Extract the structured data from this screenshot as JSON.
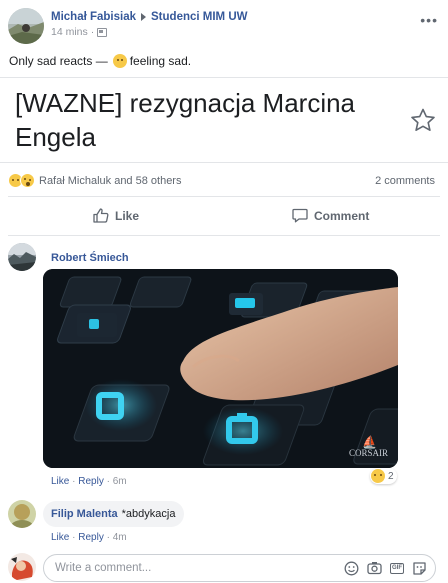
{
  "post": {
    "author": "Michał Fabisiak",
    "group": "Studenci MIM UW",
    "time": "14 mins",
    "meta_separator": "·",
    "status_text": "Only sad reacts —",
    "feeling": "feeling sad.",
    "more_icon": "more-options-icon"
  },
  "link_preview": {
    "title": "[WAZNE] rezygnacja Marcina Engela",
    "save_icon": "star-icon"
  },
  "engagement": {
    "reaction_icons": [
      "sad-reaction-icon",
      "wow-reaction-icon"
    ],
    "reactions_text": "Rafał Michaluk and 58 others",
    "comments_count": "2 comments"
  },
  "actions": {
    "like_label": "Like",
    "comment_label": "Comment"
  },
  "comments": [
    {
      "author": "Robert Śmiech",
      "media_brand": "CORSAIR",
      "like": "Like",
      "reply": "Reply",
      "sep": "·",
      "time": "6m",
      "reaction_count": "2"
    },
    {
      "author": "Filip Malenta",
      "text": "*abdykacja",
      "like": "Like",
      "reply": "Reply",
      "sep": "·",
      "time": "4m"
    }
  ],
  "composer": {
    "placeholder": "Write a comment...",
    "icons": [
      "emoji-icon",
      "camera-icon",
      "gif-icon",
      "sticker-icon"
    ],
    "gif_label": "GIF"
  },
  "colors": {
    "link_blue": "#385898",
    "meta_gray": "#90949c",
    "divider": "#e3e5e8",
    "reaction_yellow": "#f7c948",
    "key_glow": "#1fc4e6"
  }
}
